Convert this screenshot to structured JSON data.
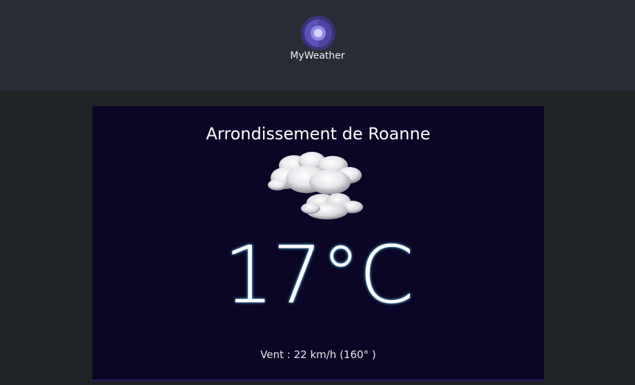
{
  "header": {
    "app_name": "MyWeather",
    "logo_icon": "weather-logo-icon"
  },
  "weather": {
    "city": "Arrondissement de Roanne",
    "condition_icon": "cloud-icon",
    "temperature": "17°C",
    "wind": "Vent : 22 km/h (160° )"
  },
  "colors": {
    "header_bg": "#282c34",
    "page_bg": "#1f2326",
    "card_bg": "#0b0626",
    "logo_accent": "#6b63d8",
    "temp_glow": "#6ad7ff"
  }
}
